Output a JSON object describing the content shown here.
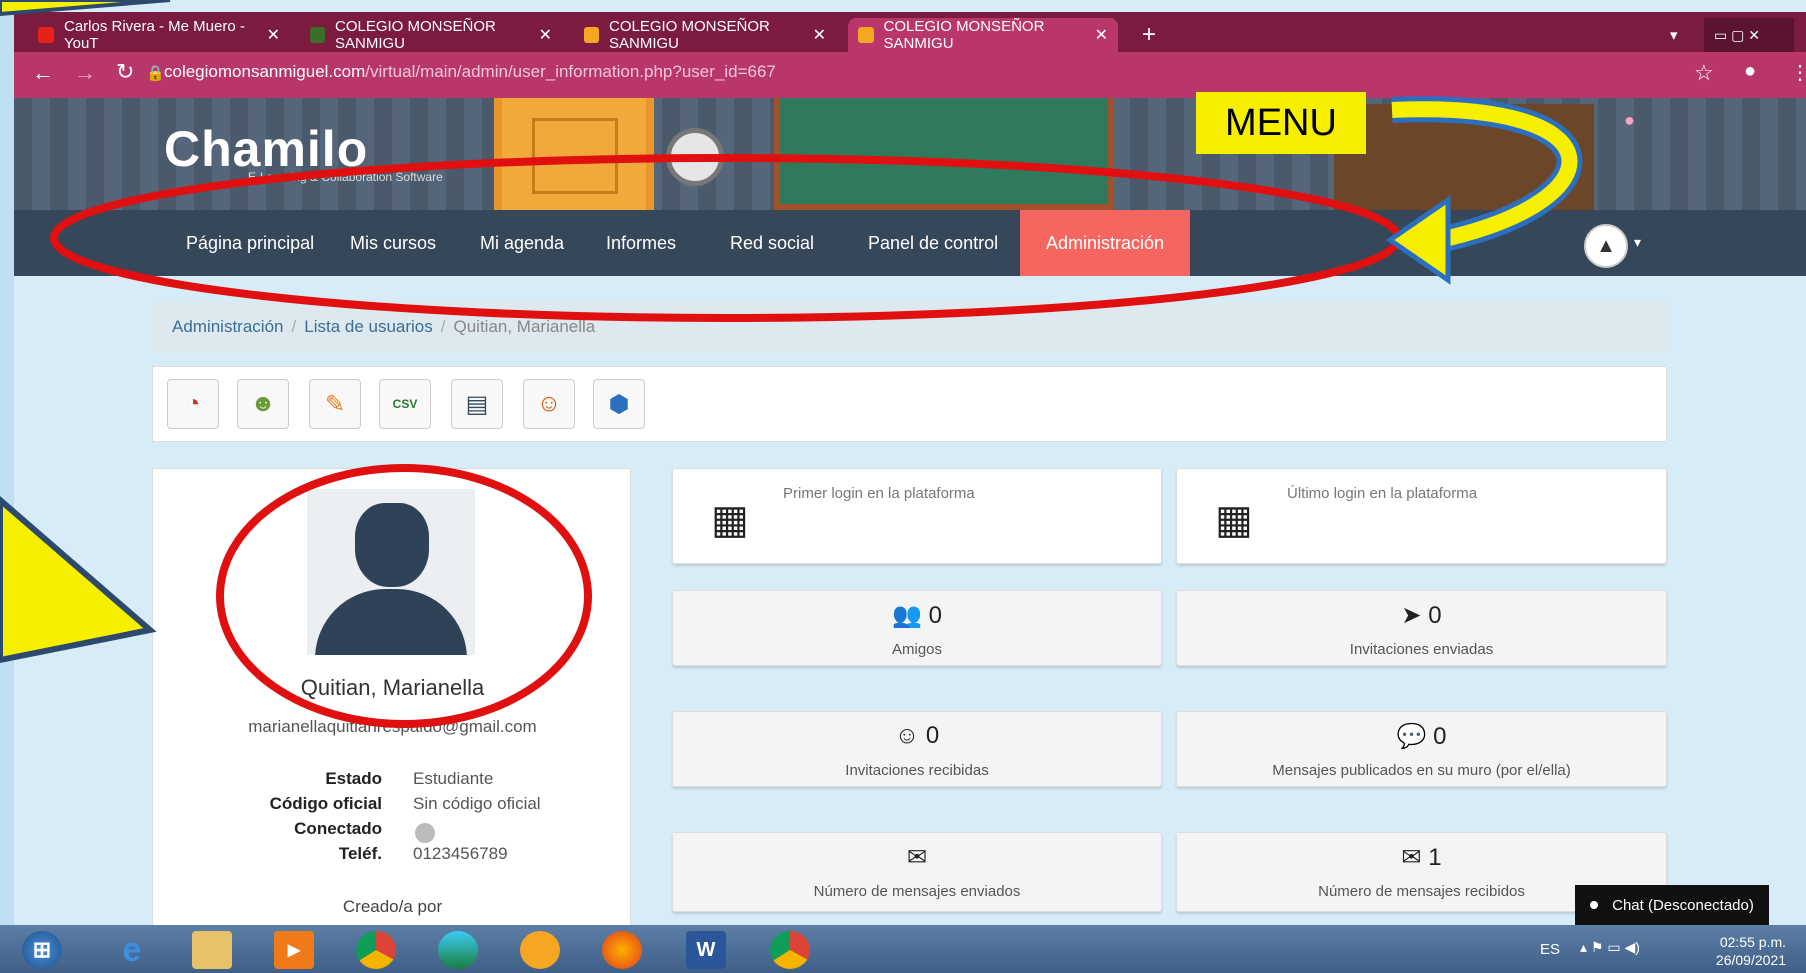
{
  "browser": {
    "tabs": [
      {
        "title": "Carlos Rivera - Me Muero - YouT",
        "fav_color": "#e62117"
      },
      {
        "title": "COLEGIO MONSEÑOR SANMIGU",
        "fav_color": "#3b6e2b"
      },
      {
        "title": "COLEGIO MONSEÑOR SANMIGU",
        "fav_color": "#f5a623"
      },
      {
        "title": "COLEGIO MONSEÑOR SANMIGU",
        "fav_color": "#f5a623"
      }
    ],
    "tab_close": "✕",
    "new_tab": "+",
    "url_host": "colegiomonsanmiguel.com",
    "url_path": "/virtual/main/admin/user_information.php?user_id=667"
  },
  "site": {
    "logo": "Chamilo",
    "logo_sub": "E-Learning & Collaboration Software",
    "annotation_label": "MENU"
  },
  "nav": {
    "items": [
      "Página principal",
      "Mis cursos",
      "Mi agenda",
      "Informes",
      "Red social",
      "Panel de control",
      "Administración"
    ],
    "active_index": 6
  },
  "breadcrumb": {
    "items": [
      "Administración",
      "Lista de usuarios"
    ],
    "current": "Quitian, Marianella"
  },
  "toolbar": {
    "icons": [
      "reports-icon",
      "login-as-icon",
      "edit-icon",
      "csv-export-icon",
      "id-card-icon",
      "users-group-icon",
      "badge-icon"
    ],
    "csv_text": "CSV"
  },
  "profile": {
    "name": "Quitian, Marianella",
    "email": "marianellaquitianrespaldo@gmail.com",
    "fields": [
      {
        "key": "Estado",
        "value": "Estudiante"
      },
      {
        "key": "Código oficial",
        "value": "Sin código oficial"
      },
      {
        "key": "Conectado",
        "value": ""
      },
      {
        "key": "Teléf.",
        "value": "0123456789"
      }
    ],
    "created_by": "Creado/a por"
  },
  "stats": {
    "first_login": "Primer login en la plataforma",
    "last_login": "Último login en la plataforma",
    "friends": {
      "value": "0",
      "label": "Amigos"
    },
    "invites_sent": {
      "value": "0",
      "label": "Invitaciones enviadas"
    },
    "invites_received": {
      "value": "0",
      "label": "Invitaciones recibidas"
    },
    "wall_posts": {
      "value": "0",
      "label": "Mensajes publicados en su muro (por el/ella)"
    },
    "messages_sent": {
      "value": "",
      "label": "Número de mensajes enviados"
    },
    "messages_received": {
      "value": "1",
      "label": "Número de mensajes recibidos"
    }
  },
  "chat": {
    "label": "Chat (Desconectado)"
  },
  "taskbar": {
    "lang": "ES",
    "time": "02:55 p.m.",
    "date": "26/09/2021"
  }
}
